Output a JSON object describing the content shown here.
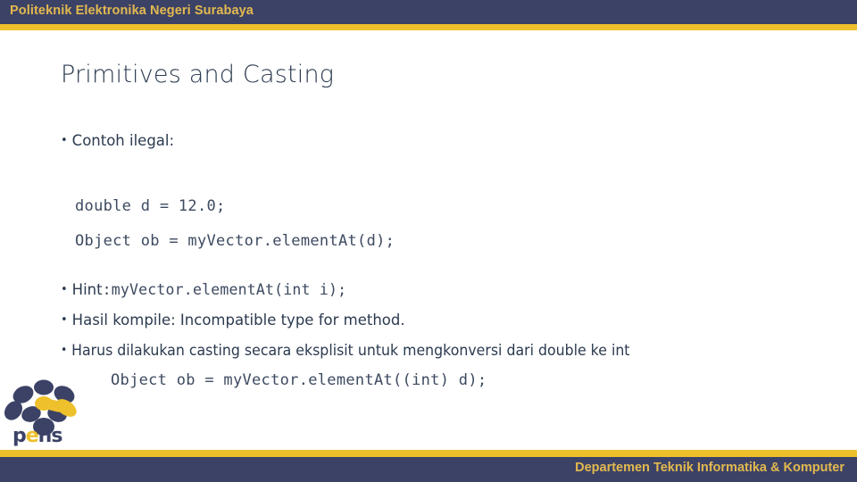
{
  "header": {
    "institution": "Politeknik Elektronika Negeri Surabaya",
    "bar_color": "#3c4266",
    "stripe_color": "#eec02b",
    "text_color": "#e3b94f"
  },
  "slide": {
    "title": "Primitives and Casting",
    "title_color": "#2b3a4f",
    "background": "#ffffff",
    "bullets": [
      {
        "bullet": "•",
        "text": "Contoh ilegal:"
      },
      {
        "bullet": "•",
        "label": "Hint",
        "separator": ":",
        "code": "myVector.elementAt(int i);"
      },
      {
        "bullet": "•",
        "text": "Hasil kompile: Incompatible type for method."
      },
      {
        "bullet": "•",
        "text": "Harus dilakukan casting secara eksplisit untuk mengkonversi dari double ke int"
      }
    ],
    "code_block": "double d = 12.0;\nObject ob = myVector.elementAt(d);",
    "code_solution": "Object ob = myVector.elementAt((int) d);",
    "code_color": "#3d4a60"
  },
  "logo": {
    "name": "pens-logo",
    "wordmark_prefix": "p",
    "wordmark_accent": "e",
    "wordmark_suffix": "ns",
    "navy": "#3c4266",
    "gold": "#eec02b"
  },
  "footer": {
    "department": "Departemen Teknik Informatika & Komputer",
    "bar_color": "#3c4266",
    "stripe_color": "#eec02b",
    "text_color": "#e3b94f"
  }
}
